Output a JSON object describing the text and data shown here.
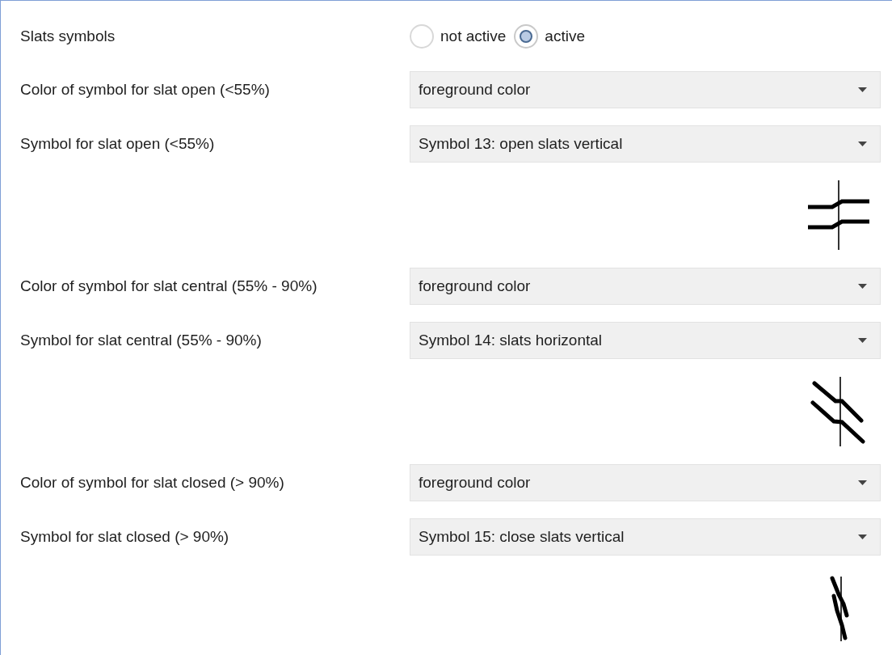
{
  "rows": [
    {
      "kind": "radio",
      "label": "Slats symbols",
      "options": [
        {
          "label": "not active",
          "selected": false
        },
        {
          "label": "active",
          "selected": true
        }
      ]
    },
    {
      "kind": "dropdown",
      "label": "Color of symbol for slat open (<55%)",
      "value": "foreground color"
    },
    {
      "kind": "dropdown",
      "label": "Symbol for slat open (<55%)",
      "value": "Symbol 13: open slats vertical"
    },
    {
      "kind": "symbol_open"
    },
    {
      "kind": "dropdown",
      "label": "Color of symbol for slat central (55% - 90%)",
      "value": "foreground color"
    },
    {
      "kind": "dropdown",
      "label": "Symbol for slat central (55% - 90%)",
      "value": "Symbol 14: slats horizontal"
    },
    {
      "kind": "symbol_central"
    },
    {
      "kind": "dropdown",
      "label": "Color of symbol for slat closed (> 90%)",
      "value": "foreground color"
    },
    {
      "kind": "dropdown",
      "label": "Symbol for slat closed (> 90%)",
      "value": "Symbol 15: close slats vertical"
    },
    {
      "kind": "symbol_closed"
    }
  ]
}
